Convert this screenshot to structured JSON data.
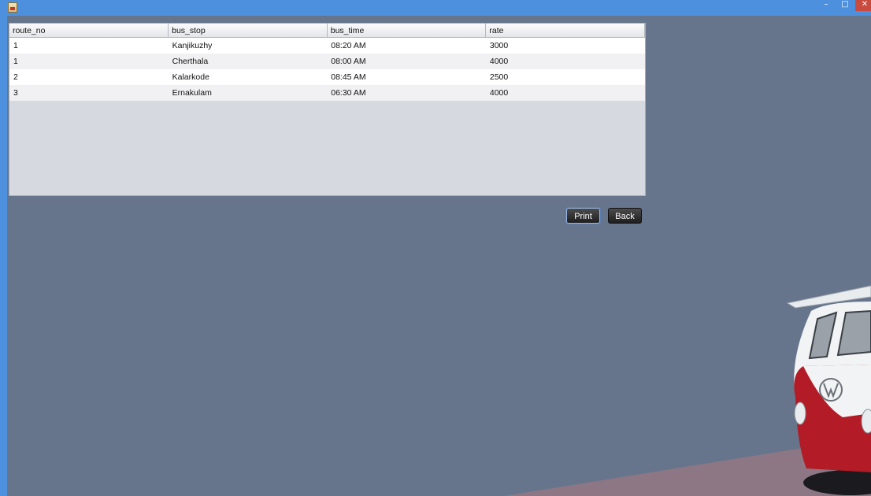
{
  "window": {
    "close_glyph": "✕",
    "minimize_glyph": "–",
    "maximize_glyph": "□"
  },
  "table": {
    "columns": [
      "route_no",
      "bus_stop",
      "bus_time",
      "rate"
    ],
    "rows": [
      [
        "1",
        "Kanjikuzhy",
        "08:20 AM",
        "3000"
      ],
      [
        "1",
        "Cherthala",
        "08:00 AM",
        "4000"
      ],
      [
        "2",
        "Kalarkode",
        "08:45 AM",
        "2500"
      ],
      [
        "3",
        "Ernakulam",
        "06:30 AM",
        "4000"
      ]
    ]
  },
  "buttons": {
    "print_label": "Print",
    "back_label": "Back"
  },
  "icons": {
    "app": "java-app-icon",
    "minimize": "minimize-icon",
    "maximize": "maximize-icon",
    "close": "close-icon"
  },
  "colors": {
    "background": "#66758b",
    "titlebar": "#4d90dd",
    "button": "#2a2a2a",
    "van_red": "#b31b27"
  }
}
